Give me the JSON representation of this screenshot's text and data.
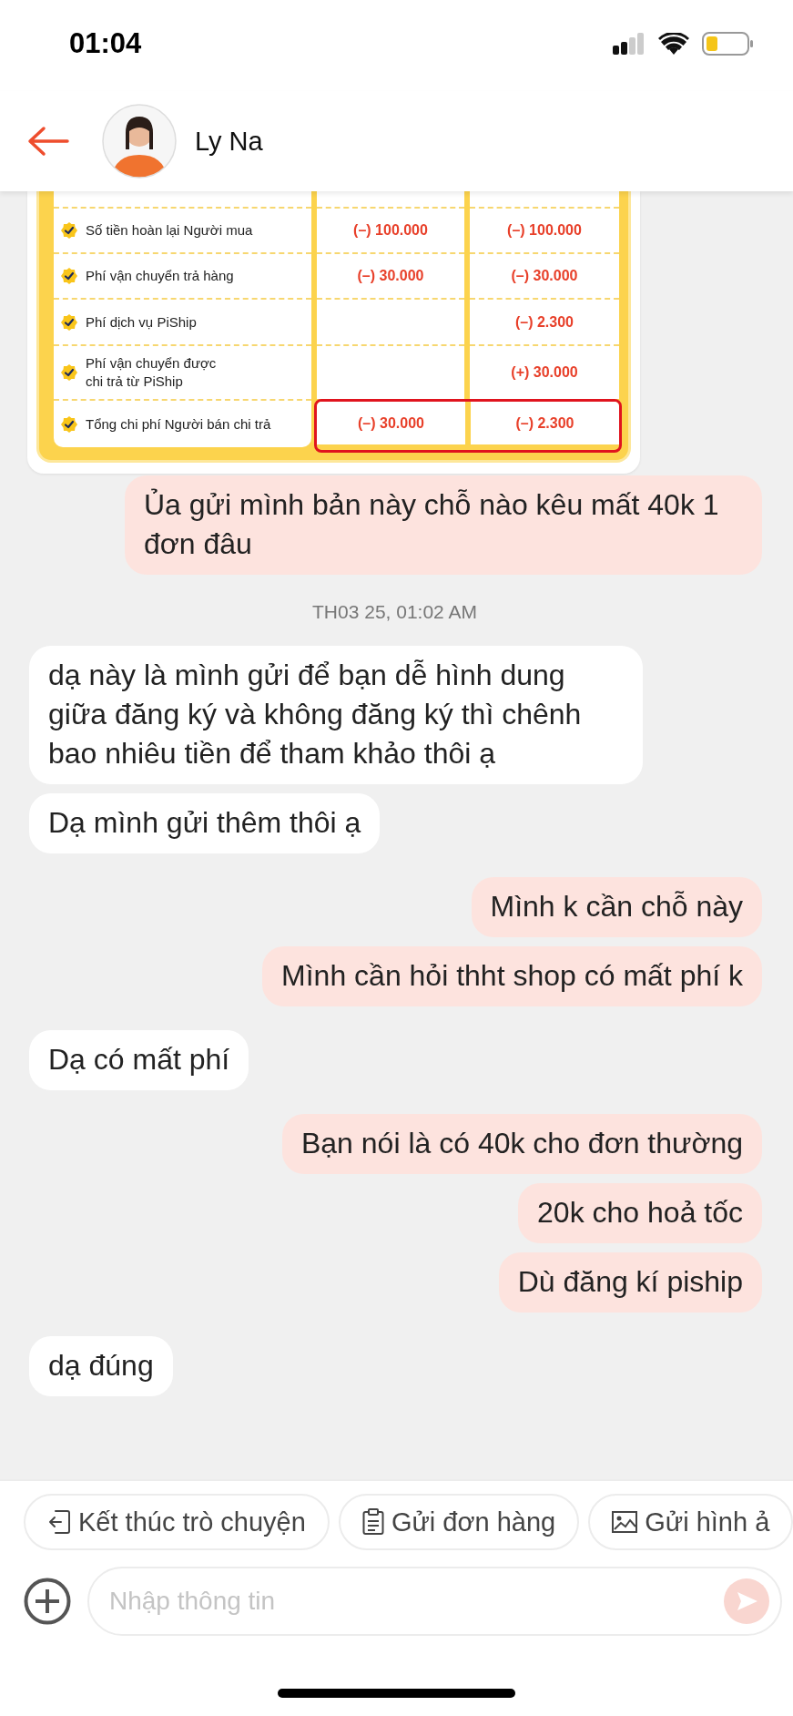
{
  "status_bar": {
    "time": "01:04"
  },
  "header": {
    "name": "Ly Na"
  },
  "messages": [
    {
      "kind": "table_image",
      "rows": [
        {
          "label": "Số tiền hoàn lại Người mua",
          "col_2": "(–) 100.000",
          "col_3": "(–) 100.000",
          "highlighted": false
        },
        {
          "label": "Phí vận chuyển trả hàng",
          "col_2": "(–) 30.000",
          "col_3": "(–) 30.000",
          "highlighted": false
        },
        {
          "label": "Phí dịch vụ PiShip",
          "col_3": "(–) 2.300",
          "highlighted": false
        },
        {
          "label": "Phí vận chuyển được\nchi trả từ PiShip",
          "col_3": "(+) 30.000",
          "highlighted": false
        },
        {
          "label": "Tổng chi phí Người bán chi trả",
          "col_2": "(–) 30.000",
          "col_3": "(–) 2.300",
          "highlighted": true
        }
      ]
    },
    {
      "kind": "outgoing",
      "text": "Ủa gửi mình bản này chỗ nào kêu mất 40k 1 đơn đâu"
    },
    {
      "kind": "timestamp",
      "text": "TH03 25, 01:02 AM"
    },
    {
      "kind": "incoming",
      "text": "dạ này là mình gửi để bạn dễ hình dung giữa đăng ký và không đăng ký thì chênh bao nhiêu tiền để tham khảo thôi ạ"
    },
    {
      "kind": "incoming",
      "text": "Dạ mình gửi thêm thôi ạ"
    },
    {
      "kind": "outgoing",
      "text": "Mình k cần chỗ này"
    },
    {
      "kind": "outgoing",
      "text": "Mình cần hỏi thht shop có mất phí k"
    },
    {
      "kind": "incoming",
      "text": "Dạ có mất phí"
    },
    {
      "kind": "outgoing",
      "text": "Bạn nói là có 40k cho đơn thường"
    },
    {
      "kind": "outgoing",
      "text": "20k cho hoả tốc"
    },
    {
      "kind": "outgoing",
      "text": "Dù đăng kí piship"
    },
    {
      "kind": "incoming",
      "text": "dạ đúng"
    }
  ],
  "quick_actions": [
    {
      "kind": "exit",
      "label": "Kết thúc trò chuyện"
    },
    {
      "kind": "order",
      "label": "Gửi đơn hàng"
    },
    {
      "kind": "image",
      "label": "Gửi hình ả"
    }
  ],
  "composer": {
    "placeholder": "Nhập thông tin"
  }
}
